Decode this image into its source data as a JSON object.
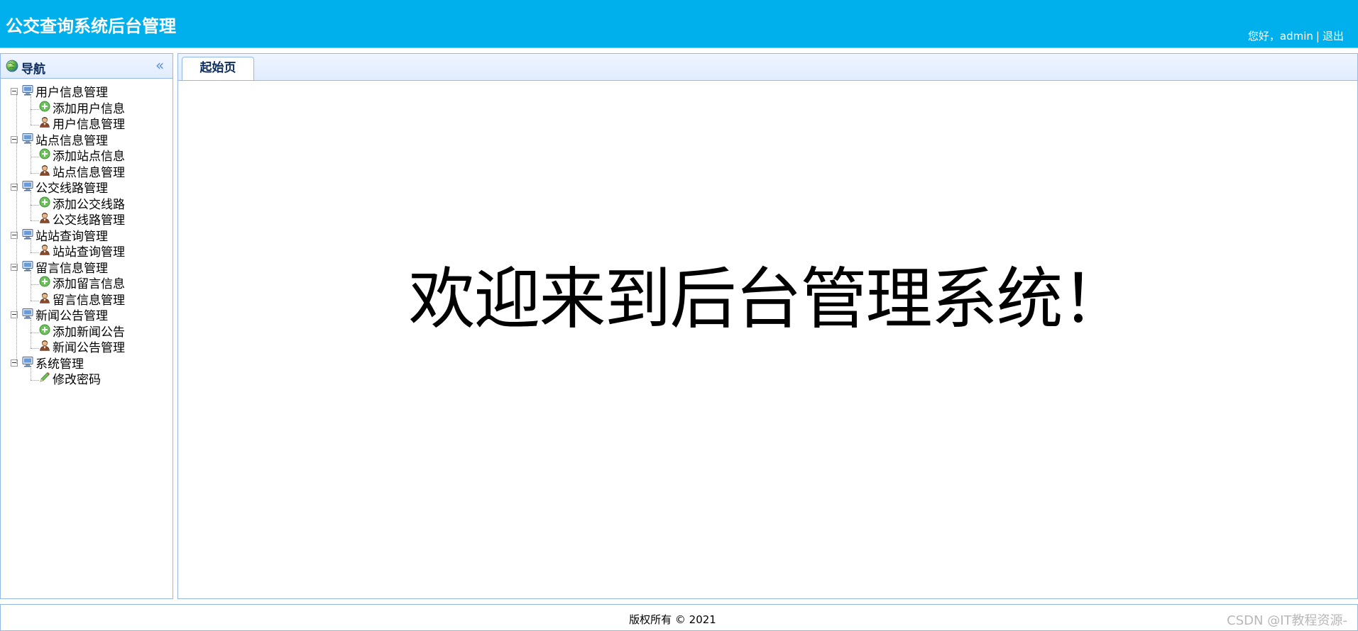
{
  "header": {
    "title": "公交查询系统后台管理",
    "greeting": "您好，admin",
    "separator": "|",
    "logout_label": "退出"
  },
  "sidebar": {
    "title": "导航",
    "collapse_icon": "double-chevron-left-icon",
    "groups": [
      {
        "label": "用户信息管理",
        "icon": "computer-icon",
        "items": [
          {
            "label": "添加用户信息",
            "icon": "add-circle-icon"
          },
          {
            "label": "用户信息管理",
            "icon": "user-icon"
          }
        ]
      },
      {
        "label": "站点信息管理",
        "icon": "computer-icon",
        "items": [
          {
            "label": "添加站点信息",
            "icon": "add-circle-icon"
          },
          {
            "label": "站点信息管理",
            "icon": "user-icon"
          }
        ]
      },
      {
        "label": "公交线路管理",
        "icon": "computer-icon",
        "items": [
          {
            "label": "添加公交线路",
            "icon": "add-circle-icon"
          },
          {
            "label": "公交线路管理",
            "icon": "user-icon"
          }
        ]
      },
      {
        "label": "站站查询管理",
        "icon": "computer-icon",
        "items": [
          {
            "label": "站站查询管理",
            "icon": "user-icon"
          }
        ]
      },
      {
        "label": "留言信息管理",
        "icon": "computer-icon",
        "items": [
          {
            "label": "添加留言信息",
            "icon": "add-circle-icon"
          },
          {
            "label": "留言信息管理",
            "icon": "user-icon"
          }
        ]
      },
      {
        "label": "新闻公告管理",
        "icon": "computer-icon",
        "items": [
          {
            "label": "添加新闻公告",
            "icon": "add-circle-icon"
          },
          {
            "label": "新闻公告管理",
            "icon": "user-icon"
          }
        ]
      },
      {
        "label": "系统管理",
        "icon": "computer-icon",
        "items": [
          {
            "label": "修改密码",
            "icon": "pencil-icon"
          }
        ]
      }
    ]
  },
  "main": {
    "tabs": [
      {
        "label": "起始页",
        "active": true
      }
    ],
    "welcome_text": "欢迎来到后台管理系统！"
  },
  "footer": {
    "copyright": "版权所有 © 2021",
    "watermark": "CSDN @IT教程资源-"
  },
  "colors": {
    "header_bg": "#00b0ec",
    "panel_border": "#95b8e7",
    "panel_head_bg": "#e0ecff",
    "title_text": "#0e2d5f"
  }
}
